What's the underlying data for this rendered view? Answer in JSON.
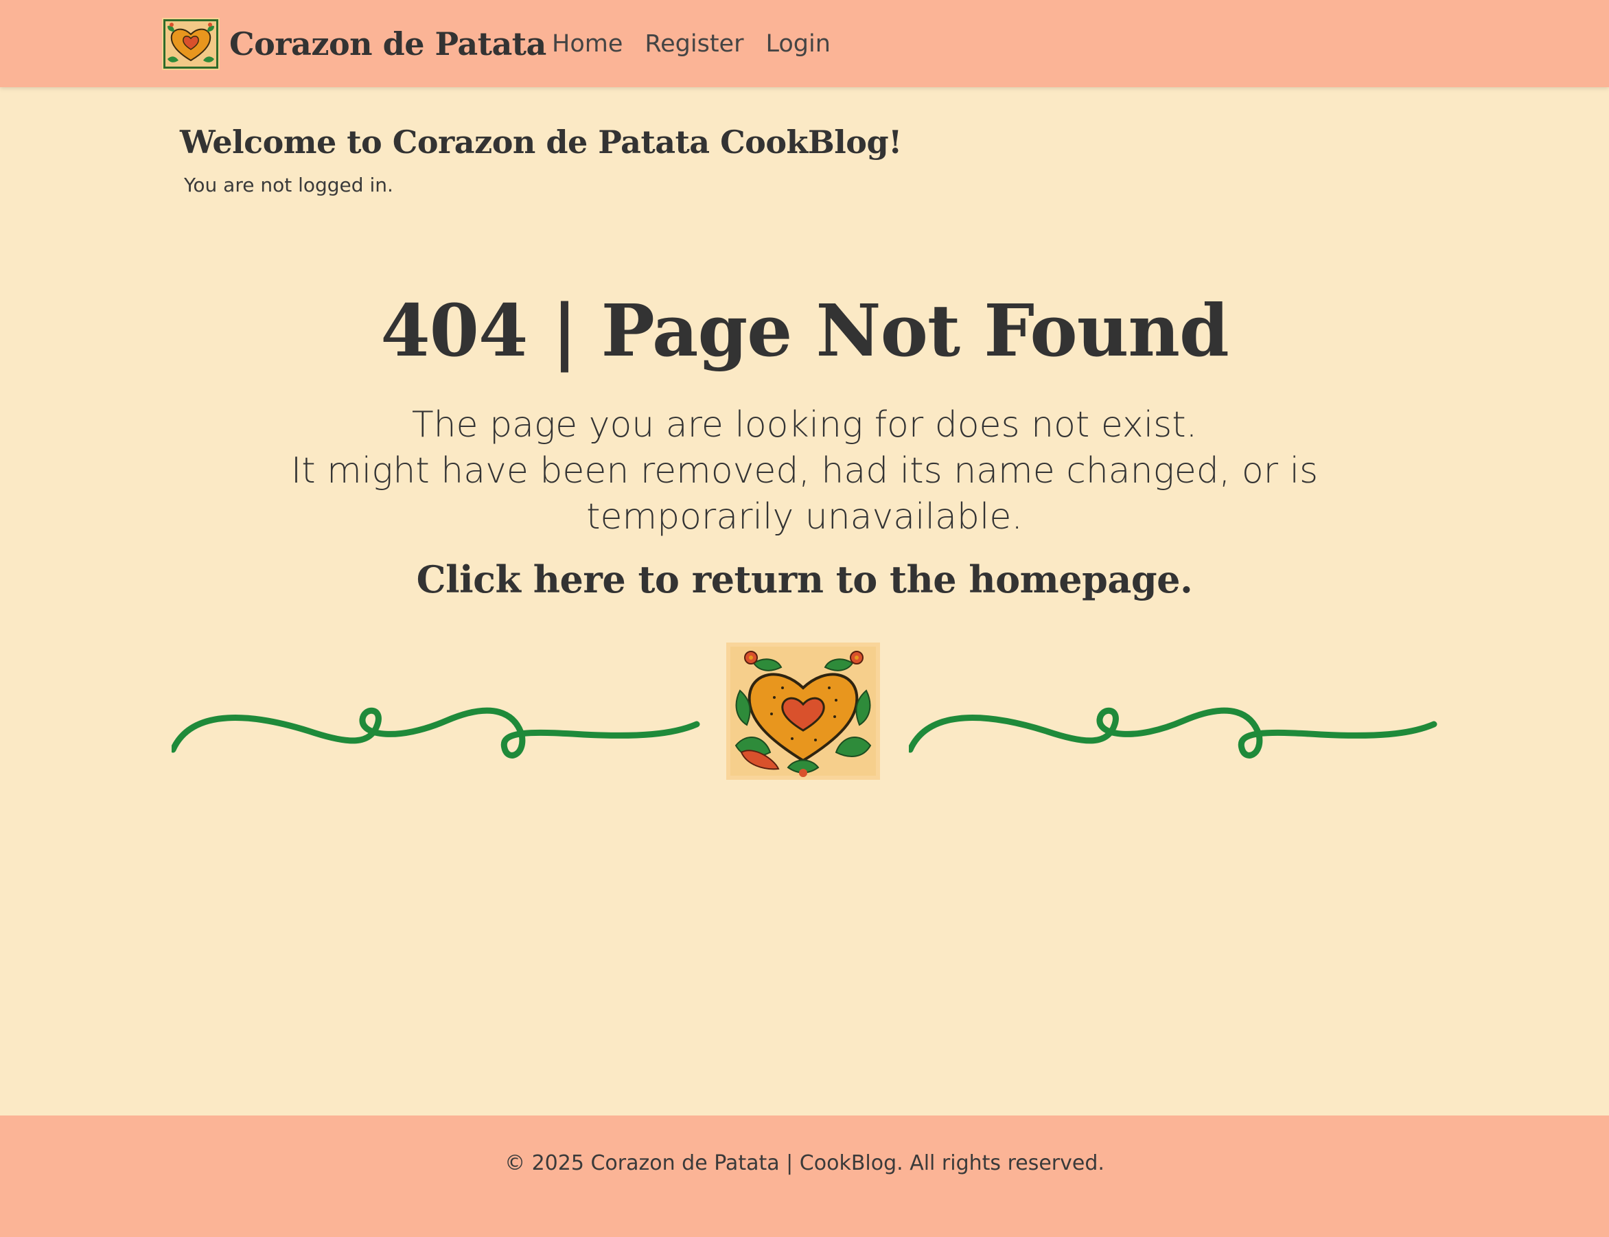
{
  "navbar": {
    "brand_name": "Corazon de Patata",
    "links": [
      {
        "label": "Home"
      },
      {
        "label": "Register"
      },
      {
        "label": "Login"
      }
    ]
  },
  "header": {
    "welcome": "Welcome to Corazon de Patata CookBlog!",
    "login_status": "You are not logged in."
  },
  "error": {
    "title": "404 | Page Not Found",
    "line1": "The page you are looking for does not exist.",
    "line2": "It might have been removed, had its name changed, or is temporarily unavailable.",
    "home_link": "Click here to return to the homepage."
  },
  "footer": {
    "text": "© 2025 Corazon de Patata | CookBlog. All rights reserved."
  },
  "colors": {
    "background": "#fbe9c5",
    "navbar": "#fbb496",
    "text": "#333333",
    "vine_green": "#1f8a3a",
    "heart_orange": "#e8961e",
    "heart_red": "#d9512c"
  }
}
